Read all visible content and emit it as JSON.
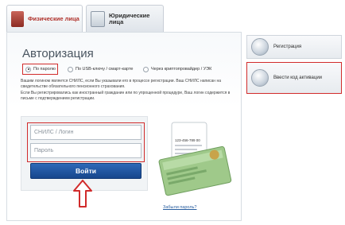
{
  "tabs": {
    "individuals": "Физические лица",
    "legal": "Юридические лица"
  },
  "auth": {
    "title": "Авторизация",
    "methods": [
      {
        "label": "По паролю",
        "selected": true
      },
      {
        "label": "По USB-ключу / смарт-карте",
        "selected": false
      },
      {
        "label": "Через криптопровайдер / УЭК",
        "selected": false
      }
    ],
    "desc1": "Вашим логином является СНИЛС, если Вы указывали его в процессе регистрации. Ваш СНИЛС написан на свидетельстве обязательного пенсионного страхования.",
    "desc2": "Если Вы регистрировались как иностранный гражданин или по упрощенной процедуре, Ваш логин содержится в письме с подтверждением регистрации.",
    "login_placeholder": "СНИЛС / Логин",
    "password_placeholder": "Пароль",
    "submit": "Войти",
    "forgot": "Забыли пароль?",
    "card_number": "123-456-789 00"
  },
  "sidebar": {
    "register": "Регистрация",
    "activation": "Ввести код активации"
  },
  "colors": {
    "highlight": "#d12b2b",
    "button": "#1f55a3",
    "tab_active_text": "#b0312a"
  }
}
